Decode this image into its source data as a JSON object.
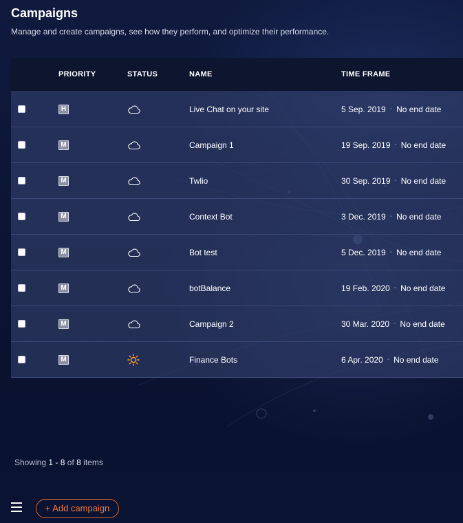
{
  "header": {
    "title": "Campaigns",
    "description": "Manage and create campaigns, see how they perform, and optimize their performance."
  },
  "table": {
    "columns": {
      "priority": "PRIORITY",
      "status": "STATUS",
      "name": "NAME",
      "time_frame": "TIME FRAME"
    },
    "rows": [
      {
        "priority": "H",
        "status_icon": "cloud-icon",
        "name": "Live Chat on your site",
        "start": "5 Sep. 2019",
        "separator": "-",
        "end": "No end date"
      },
      {
        "priority": "M",
        "status_icon": "cloud-icon",
        "name": "Campaign 1",
        "start": "19 Sep. 2019",
        "separator": "-",
        "end": "No end date"
      },
      {
        "priority": "M",
        "status_icon": "cloud-icon",
        "name": "Twlio",
        "start": "30 Sep. 2019",
        "separator": "-",
        "end": "No end date"
      },
      {
        "priority": "M",
        "status_icon": "cloud-icon",
        "name": "Context Bot",
        "start": "3 Dec. 2019",
        "separator": "-",
        "end": "No end date"
      },
      {
        "priority": "M",
        "status_icon": "cloud-icon",
        "name": "Bot test",
        "start": "5 Dec. 2019",
        "separator": "-",
        "end": "No end date"
      },
      {
        "priority": "M",
        "status_icon": "cloud-icon",
        "name": "botBalance",
        "start": "19 Feb. 2020",
        "separator": "-",
        "end": "No end date"
      },
      {
        "priority": "M",
        "status_icon": "cloud-icon",
        "name": "Campaign 2",
        "start": "30 Mar. 2020",
        "separator": "-",
        "end": "No end date"
      },
      {
        "priority": "M",
        "status_icon": "sun-icon",
        "name": "Finance Bots",
        "start": "6 Apr. 2020",
        "separator": "-",
        "end": "No end date"
      }
    ]
  },
  "footer": {
    "showing_label": "Showing",
    "range_start": "1",
    "range_dash": "-",
    "range_end": "8",
    "of_label": "of",
    "total": "8",
    "items_label": "items",
    "add_button": "+ Add campaign"
  },
  "colors": {
    "accent": "#f07a3e",
    "sun": "#f5a623"
  }
}
